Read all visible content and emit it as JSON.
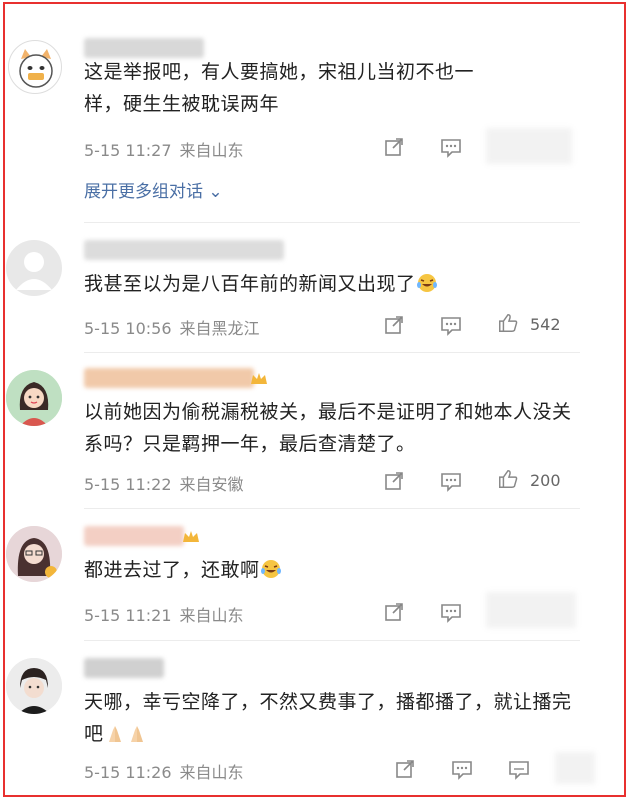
{
  "comments": [
    {
      "name": "",
      "text": "这是举报吧，有人要搞她，宋祖儿当初不也一样，硬生生被耽误两年",
      "time": "5-15 11:27",
      "location": "来自山东",
      "likes": ""
    },
    {
      "name": "",
      "text": "我甚至以为是八百年前的新闻又出现了",
      "time": "5-15 10:56",
      "location": "来自黑龙江",
      "likes": "542"
    },
    {
      "name": "",
      "text": "以前她因为偷税漏税被关，最后不是证明了和她本人没关系吗？只是羁押一年，最后查清楚了。",
      "time": "5-15 11:22",
      "location": "来自安徽",
      "likes": "200"
    },
    {
      "name": "",
      "text": "都进去过了，还敢啊",
      "time": "5-15 11:21",
      "location": "来自山东",
      "likes": ""
    },
    {
      "name": "",
      "text": "天哪，幸亏空降了，不然又费事了，播都播了，就让播完吧",
      "time": "5-15 11:26",
      "location": "来自山东",
      "likes": ""
    }
  ],
  "expand_label": "展开更多组对话",
  "colors": {
    "border": "#e8302f",
    "link": "#4a6fa5",
    "meta": "#8a8a8a"
  }
}
